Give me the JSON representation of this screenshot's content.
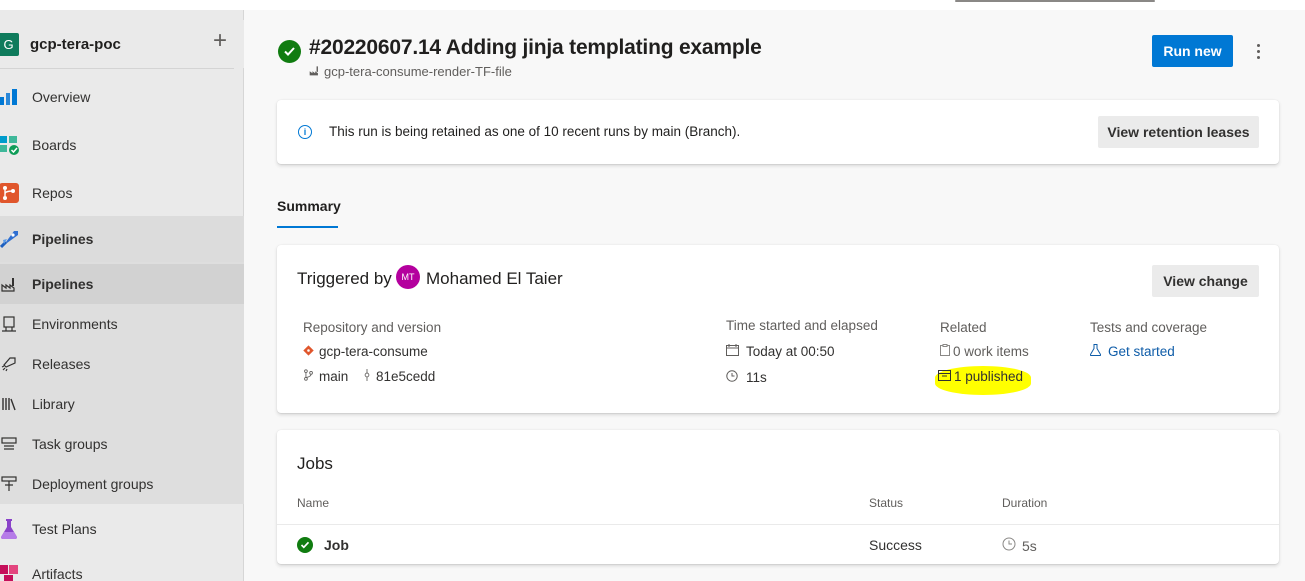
{
  "project": {
    "avatar_letter": "G",
    "name": "gcp-tera-poc"
  },
  "nav": {
    "overview": "Overview",
    "boards": "Boards",
    "repos": "Repos",
    "pipelines_group": "Pipelines",
    "pipelines": "Pipelines",
    "environments": "Environments",
    "releases": "Releases",
    "library": "Library",
    "task_groups": "Task groups",
    "deployment_groups": "Deployment groups",
    "test_plans": "Test Plans",
    "artifacts": "Artifacts"
  },
  "run": {
    "title": "#20220607.14 Adding jinja templating example",
    "pipeline_name": "gcp-tera-consume-render-TF-file",
    "run_new_label": "Run new"
  },
  "retention": {
    "message": "This run is being retained as one of 10 recent runs by main (Branch).",
    "button_label": "View retention leases"
  },
  "tabs": {
    "summary": "Summary"
  },
  "summary": {
    "triggered_by_label": "Triggered by",
    "user_initials": "MT",
    "user_name": "Mohamed El Taier",
    "view_change_label": "View change",
    "repo_header": "Repository and version",
    "repo_name": "gcp-tera-consume",
    "branch": "main",
    "commit": "81e5cedd",
    "time_header": "Time started and elapsed",
    "started": "Today at 00:50",
    "elapsed": "11s",
    "related_header": "Related",
    "work_items": "0 work items",
    "published": "1 published",
    "tests_header": "Tests and coverage",
    "get_started": "Get started"
  },
  "jobs": {
    "title": "Jobs",
    "col_name": "Name",
    "col_status": "Status",
    "col_duration": "Duration",
    "rows": [
      {
        "name": "Job",
        "status": "Success",
        "duration": "5s"
      }
    ]
  },
  "colors": {
    "accent": "#0078d4",
    "success": "#107c10",
    "highlight": "#ffff00",
    "avatar": "#b4009e"
  }
}
